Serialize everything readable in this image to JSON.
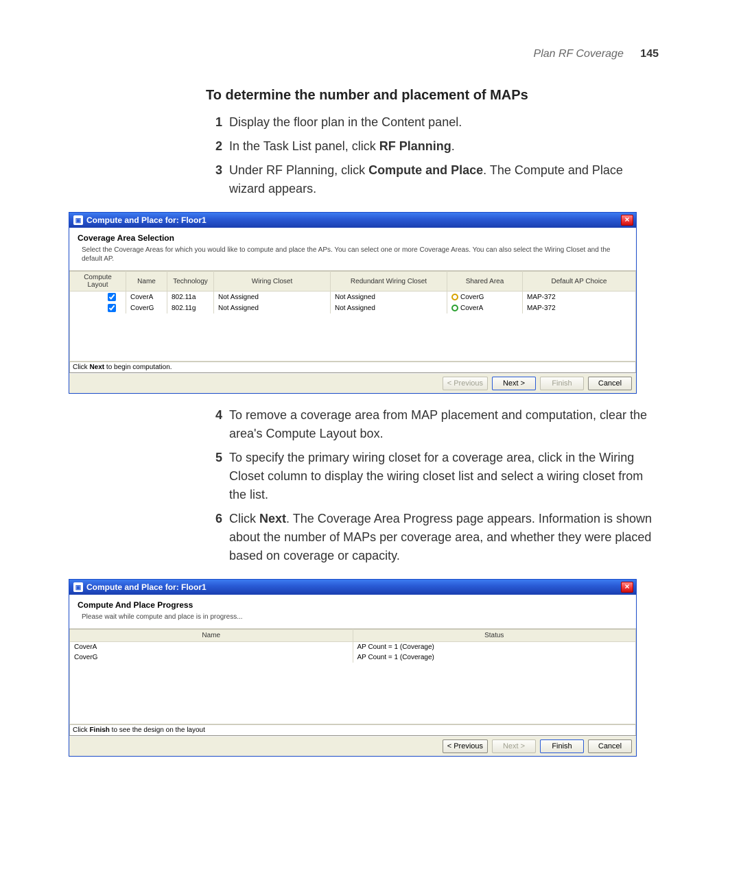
{
  "header": {
    "section": "Plan RF Coverage",
    "page": "145"
  },
  "proc": {
    "title": "To determine the number and placement of MAPs",
    "steps_a": [
      {
        "n": "1",
        "html": "Display the floor plan in the Content panel."
      },
      {
        "n": "2",
        "html": "In the Task List panel, click <b>RF Planning</b>."
      },
      {
        "n": "3",
        "html": "Under RF Planning, click <b>Compute and Place</b>. The Compute and Place wizard appears."
      }
    ],
    "steps_b": [
      {
        "n": "4",
        "html": "To remove a coverage area from MAP placement and computation, clear the area's Compute Layout box."
      },
      {
        "n": "5",
        "html": "To specify the primary wiring closet for a coverage area, click in the Wiring Closet column to display the wiring closet list and select a wiring closet from the list."
      },
      {
        "n": "6",
        "html": "Click <b>Next</b>. The Coverage Area Progress page appears. Information is shown about the number of MAPs per coverage area, and whether they were placed based on coverage or capacity."
      }
    ]
  },
  "wiz1": {
    "title": "Compute and Place for: Floor1",
    "head": "Coverage Area Selection",
    "desc": "Select the Coverage Areas for which you would like to compute and place the APs. You can select one or more Coverage Areas. You can also select the Wiring Closet and the default AP.",
    "cols": [
      "Compute Layout",
      "Name",
      "Technology",
      "Wiring Closet",
      "Redundant Wiring Closet",
      "Shared Area",
      "Default AP Choice"
    ],
    "rows": [
      {
        "checked": true,
        "name": "CoverA",
        "tech": "802.11a",
        "wc": "Not Assigned",
        "rwc": "Not Assigned",
        "shared": "CoverG",
        "shared_color": "cG",
        "ap": "MAP-372"
      },
      {
        "checked": true,
        "name": "CoverG",
        "tech": "802.11g",
        "wc": "Not Assigned",
        "rwc": "Not Assigned",
        "shared": "CoverA",
        "shared_color": "cA",
        "ap": "MAP-372"
      }
    ],
    "hint_pre": "Click ",
    "hint_bold": "Next",
    "hint_post": " to begin computation.",
    "buttons": {
      "prev": "< Previous",
      "next": "Next >",
      "finish": "Finish",
      "cancel": "Cancel"
    },
    "enabled": {
      "prev": false,
      "next": true,
      "finish": false,
      "cancel": true
    }
  },
  "wiz2": {
    "title": "Compute and Place for: Floor1",
    "head": "Compute And Place Progress",
    "desc": "Please wait while compute and place is in progress...",
    "cols": [
      "Name",
      "Status"
    ],
    "rows": [
      {
        "name": "CoverA",
        "status": "AP Count = 1 (Coverage)"
      },
      {
        "name": "CoverG",
        "status": "AP Count = 1 (Coverage)"
      }
    ],
    "hint_pre": "Click ",
    "hint_bold": "Finish",
    "hint_post": " to see the design on the layout",
    "buttons": {
      "prev": "< Previous",
      "next": "Next >",
      "finish": "Finish",
      "cancel": "Cancel"
    },
    "enabled": {
      "prev": true,
      "next": false,
      "finish": true,
      "cancel": true
    }
  }
}
